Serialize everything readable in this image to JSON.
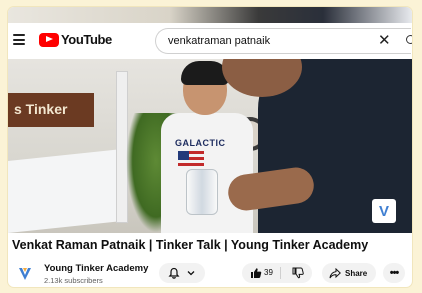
{
  "header": {
    "logo_text": "YouTube",
    "search_query": "venkatraman patnaik"
  },
  "video": {
    "sign_text": "s Tinker",
    "shirt_text": "GALACTIC"
  },
  "title": "Venkat Raman Patnaik | Tinker Talk | Young Tinker Academy",
  "channel": {
    "name": "Young Tinker Academy",
    "subscribers": "2.13k subscribers"
  },
  "actions": {
    "like_count": "39",
    "share_label": "Share"
  },
  "colors": {
    "brand_red": "#ff0000",
    "channel_logo_blue": "#3f7fd2",
    "page_bg": "#fbf3d6"
  }
}
